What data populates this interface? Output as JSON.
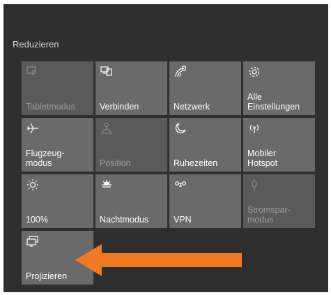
{
  "action_center": {
    "collapse_label": "Reduzieren",
    "tiles": [
      {
        "label": "Tabletmodus",
        "icon": "tablet-mode-icon",
        "enabled": false
      },
      {
        "label": "Verbinden",
        "icon": "connect-icon",
        "enabled": true
      },
      {
        "label": "Netzwerk",
        "icon": "network-icon",
        "enabled": true
      },
      {
        "label": "Alle\nEinstellungen",
        "icon": "gear-icon",
        "enabled": true
      },
      {
        "label": "Flugzeug-\nmodus",
        "icon": "airplane-icon",
        "enabled": true
      },
      {
        "label": "Position",
        "icon": "location-icon",
        "enabled": false
      },
      {
        "label": "Ruhezeiten",
        "icon": "moon-icon",
        "enabled": true
      },
      {
        "label": "Mobiler\nHotspot",
        "icon": "hotspot-icon",
        "enabled": true
      },
      {
        "label": "100%",
        "icon": "brightness-icon",
        "enabled": true
      },
      {
        "label": "Nachtmodus",
        "icon": "night-light-icon",
        "enabled": true
      },
      {
        "label": "VPN",
        "icon": "vpn-icon",
        "enabled": true
      },
      {
        "label": "Stromspar-\nmodus",
        "icon": "battery-saver-icon",
        "enabled": false
      },
      {
        "label": "Projizieren",
        "icon": "project-icon",
        "enabled": true
      }
    ]
  },
  "colors": {
    "panel_background": "#2f2f2f",
    "tile_background": "#6a6a6a",
    "disabled_tile_background": "#5a5a5a",
    "annotation_arrow": "#f07a24"
  }
}
